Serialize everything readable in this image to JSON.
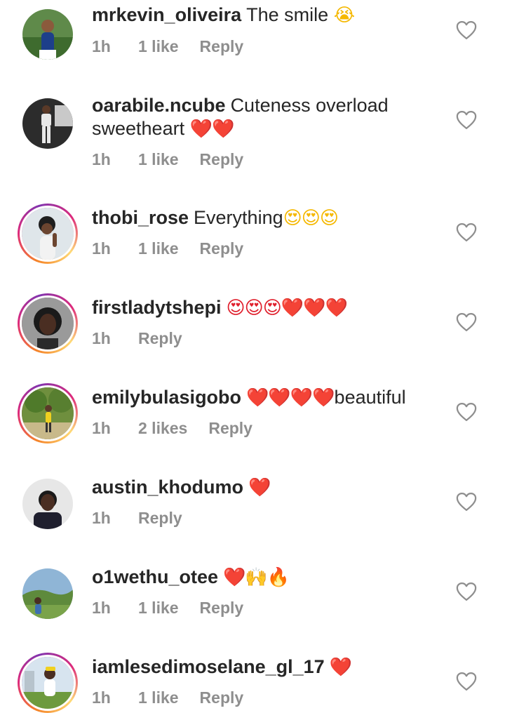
{
  "comments": [
    {
      "username": "mrkevin_oliveira",
      "text": "The smile",
      "emoji": "😭",
      "time": "1h",
      "likes": "1 like",
      "reply": "Reply",
      "story": false
    },
    {
      "username": "oarabile.ncube",
      "text": "Cuteness overload sweetheart",
      "emoji": "❤️❤️",
      "time": "1h",
      "likes": "1 like",
      "reply": "Reply",
      "story": false
    },
    {
      "username": "thobi_rose",
      "text": "Everything",
      "emoji": "😍😍😍",
      "time": "1h",
      "likes": "1 like",
      "reply": "Reply",
      "story": true
    },
    {
      "username": "firstladytshepi",
      "text": "",
      "emoji": "😍😍😍❤️❤️❤️",
      "time": "1h",
      "likes": "",
      "reply": "Reply",
      "story": true
    },
    {
      "username": "emilybulasigobo",
      "text": "beautiful",
      "emoji": "❤️❤️❤️❤️",
      "time": "1h",
      "likes": "2 likes",
      "reply": "Reply",
      "story": true
    },
    {
      "username": "austin_khodumo",
      "text": "",
      "emoji": "❤️",
      "time": "1h",
      "likes": "",
      "reply": "Reply",
      "story": false
    },
    {
      "username": "o1wethu_otee",
      "text": "",
      "emoji": "❤️🙌🔥",
      "time": "1h",
      "likes": "1 like",
      "reply": "Reply",
      "story": false
    },
    {
      "username": "iamlesedimoselane_gl_17",
      "text": "",
      "emoji": "❤️",
      "time": "1h",
      "likes": "1 like",
      "reply": "Reply",
      "story": true
    }
  ],
  "icons": {
    "like": "heart-outline-icon"
  },
  "colors": {
    "username": "#262626",
    "meta": "#8e8e8e",
    "heart": "#e0202d"
  }
}
